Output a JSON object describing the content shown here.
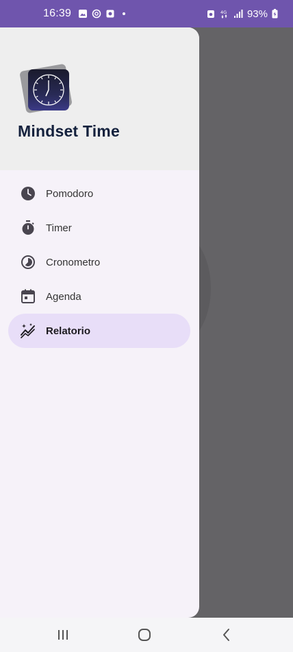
{
  "status_bar": {
    "time": "16:39",
    "battery_percent": "93%",
    "network": "4G"
  },
  "drawer": {
    "app_title": "Mindset Time",
    "items": [
      {
        "label": "Pomodoro",
        "icon": "clock-icon",
        "active": false
      },
      {
        "label": "Timer",
        "icon": "stopwatch-icon",
        "active": false
      },
      {
        "label": "Cronometro",
        "icon": "timelapse-icon",
        "active": false
      },
      {
        "label": "Agenda",
        "icon": "calendar-icon",
        "active": false
      },
      {
        "label": "Relatorio",
        "icon": "auto-graph-icon",
        "active": true
      }
    ]
  },
  "colors": {
    "status_bar": "#6f55ad",
    "drawer_bg": "#f6f2f9",
    "header_bg": "#eeeeee",
    "active_item": "#e8def8",
    "scrim": "#646366",
    "title": "#14213d"
  }
}
